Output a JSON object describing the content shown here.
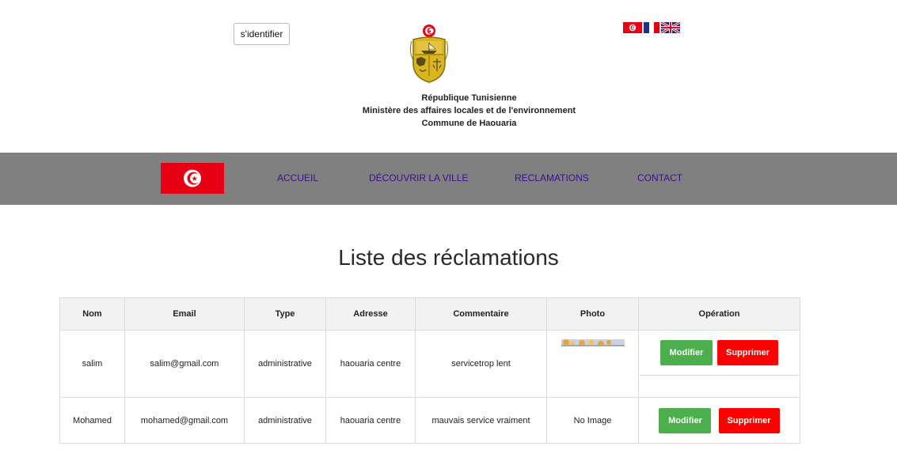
{
  "header": {
    "login_label": "s'identifier",
    "gov_lines": [
      "République Tunisienne",
      "Ministère des affaires locales et de l'environnement",
      "Commune de Haouaria"
    ],
    "languages": [
      "Arabic",
      "French",
      "English"
    ]
  },
  "nav": {
    "items": [
      {
        "label": "ACCUEIL"
      },
      {
        "label": "DÉCOUVRIR LA VILLE"
      },
      {
        "label": "RECLAMATIONS"
      },
      {
        "label": "CONTACT"
      }
    ]
  },
  "page_title": "Liste des réclamations",
  "table": {
    "headers": [
      "Nom",
      "Email",
      "Type",
      "Adresse",
      "Commentaire",
      "Photo",
      "Opération"
    ],
    "rows": [
      {
        "nom": "salim",
        "email": "salim@gmail.com",
        "type": "administrative",
        "adresse": "haouaria centre",
        "commentaire": "servicetrop lent",
        "photo": "",
        "modifier": "Modifier",
        "supprimer": "Supprimer"
      },
      {
        "nom": "Mohamed",
        "email": "mohamed@gmail.com",
        "type": "administrative",
        "adresse": "haouaria centre",
        "commentaire": "mauvais service vraiment",
        "photo": "No Image",
        "modifier": "Modifier",
        "supprimer": "Supprimer"
      }
    ]
  },
  "colors": {
    "navbar": "#808080",
    "nav_link": "#3b0f8c",
    "modifier_button": "#4cae4c",
    "supprimer_button": "#ff0000",
    "flag_red": "#e70013"
  }
}
